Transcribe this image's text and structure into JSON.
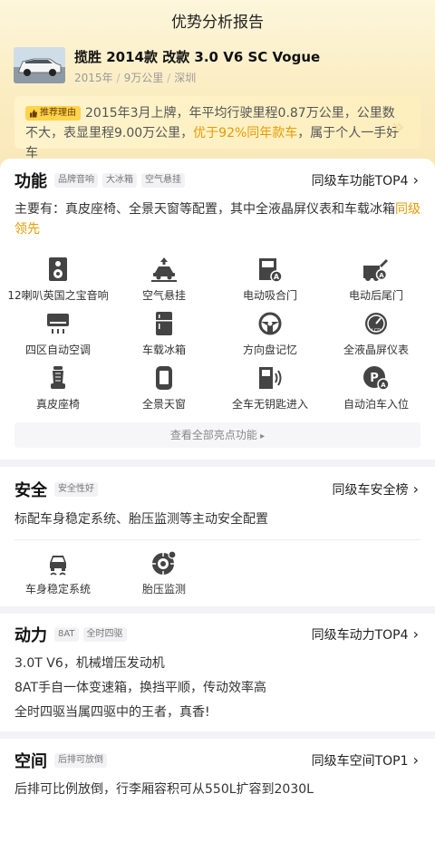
{
  "page_title": "优势分析报告",
  "car": {
    "name": "揽胜 2014款 改款 3.0 V6 SC Vogue",
    "year": "2015年",
    "mileage": "9万公里",
    "city": "深圳"
  },
  "recommend": {
    "badge": "推荐理由",
    "text_before": "2015年3月上牌，年平均行驶里程0.87万公里，公里数不大，表显里程9.00万公里，",
    "highlight": "优于92%同年款车",
    "text_after": "，属于个人一手好车"
  },
  "function": {
    "title": "功能",
    "tags": [
      "品牌音响",
      "大冰箱",
      "空气悬挂"
    ],
    "link": "同级车功能TOP4",
    "desc_before": "主要有：真皮座椅、全景天窗等配置，其中全液晶屏仪表和车载冰箱",
    "desc_highlight": "同级领先",
    "features": [
      {
        "label": "12喇叭英国之宝音响",
        "icon": "speaker-icon"
      },
      {
        "label": "空气悬挂",
        "icon": "air-suspension-icon"
      },
      {
        "label": "电动吸合门",
        "icon": "soft-close-door-icon"
      },
      {
        "label": "电动后尾门",
        "icon": "power-tailgate-icon"
      },
      {
        "label": "四区自动空调",
        "icon": "air-conditioner-icon"
      },
      {
        "label": "车载冰箱",
        "icon": "fridge-icon"
      },
      {
        "label": "方向盘记忆",
        "icon": "steering-wheel-icon"
      },
      {
        "label": "全液晶屏仪表",
        "icon": "lcd-gauge-icon"
      },
      {
        "label": "真皮座椅",
        "icon": "leather-seat-icon"
      },
      {
        "label": "全景天窗",
        "icon": "panoramic-sunroof-icon"
      },
      {
        "label": "全车无钥匙进入",
        "icon": "keyless-entry-icon"
      },
      {
        "label": "自动泊车入位",
        "icon": "auto-parking-icon"
      }
    ],
    "view_all": "查看全部亮点功能"
  },
  "safety": {
    "title": "安全",
    "tags": [
      "安全性好"
    ],
    "link": "同级车安全榜",
    "desc": "标配车身稳定系统、胎压监测等主动安全配置",
    "features": [
      {
        "label": "车身稳定系统",
        "icon": "stability-control-icon"
      },
      {
        "label": "胎压监测",
        "icon": "tire-pressure-icon"
      }
    ]
  },
  "power": {
    "title": "动力",
    "tags": [
      "8AT",
      "全时四驱"
    ],
    "link": "同级车动力TOP4",
    "lines": [
      "3.0T V6，机械增压发动机",
      "8AT手自一体变速箱，换挡平顺，传动效率高",
      "全时四驱当属四驱中的王者，真香!"
    ]
  },
  "space": {
    "title": "空间",
    "tags": [
      "后排可放倒"
    ],
    "link": "同级车空间TOP1",
    "desc": "后排可比例放倒，行李厢容积可从550L扩容到2030L"
  },
  "colors": {
    "accent": "#e89a00",
    "badge": "#ffd34a",
    "header_bg": "#fbedc2"
  }
}
